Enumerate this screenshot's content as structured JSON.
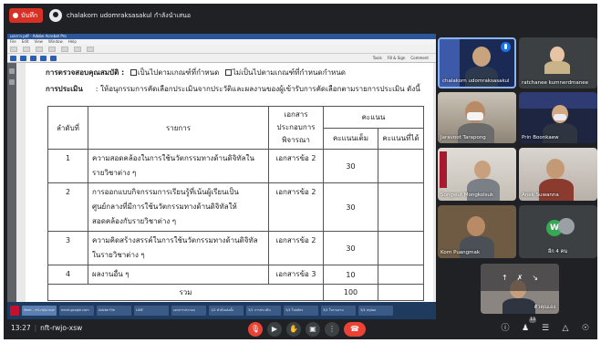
{
  "meeting": {
    "recording_label": "บันทึก",
    "presenter_name": "chalakorn udomraksasakul กำลังนำเสนอ",
    "time": "13:27",
    "meeting_code": "nft-rwjo-xsw",
    "participant_count": "13"
  },
  "shared_screen": {
    "app_title": "เอกสาร.pdf - Adobe Acrobat Pro",
    "menu": [
      "File",
      "Edit",
      "View",
      "Window",
      "Help"
    ],
    "toolbar_right": [
      "Tools",
      "Fill & Sign",
      "Comment"
    ],
    "document": {
      "criteria_label": "การตรวจสอบคุณสมบัติ :",
      "criteria_option_1": "เป็นไปตามเกณฑ์ที่กำหนด",
      "criteria_option_2": "ไม่เป็นไปตามเกณฑ์ที่กำหนดกำหนด",
      "method_label": "การประเมิน",
      "method_text": ": ให้อนุกรรมการคัดเลือกประเมินจากประวัติและผลงานของผู้เข้ารับการคัดเลือกตามรายการประเมิน ดังนี้",
      "table": {
        "headers": {
          "no": "ลำดับที่",
          "item": "รายการ",
          "doc": "เอกสาร ประกอบการ พิจารณา",
          "score": "คะแนน",
          "full": "คะแนนเต็ม",
          "got": "คะแนนที่ได้"
        },
        "rows": [
          {
            "no": "1",
            "item": "ความสอดคล้องในการใช้นวัตกรรมทางด้านดิจิทัลในรายวิชาต่าง ๆ",
            "doc": "เอกสารข้อ 2",
            "full": "30",
            "got": ""
          },
          {
            "no": "2",
            "item": "การออกแบบกิจกรรมการเรียนรู้ที่เน้นผู้เรียนเป็นศูนย์กลางที่มีการใช้นวัตกรรมทางด้านดิจิทัลให้สอดคล้องกับรายวิชาต่าง ๆ",
            "doc": "เอกสารข้อ 2",
            "full": "30",
            "got": ""
          },
          {
            "no": "3",
            "item": "ความคิดสร้างสรรค์ในการใช้นวัตกรรมทางด้านดิจิทัลในรายวิชาต่าง ๆ",
            "doc": "เอกสารข้อ 2",
            "full": "30",
            "got": ""
          },
          {
            "no": "4",
            "item": "ผลงานอื่น ๆ",
            "doc": "เอกสารข้อ 3",
            "full": "10",
            "got": ""
          }
        ],
        "total_label": "รวม",
        "total_full": "100"
      }
    },
    "taskbar_items": [
      "Meet - nft-rwjo-xsw",
      "meet.google.com",
      "Adobe File",
      "LINE",
      "เอกสารประกอบ",
      "1/2 คำสั่งแต่งตั้ง",
      "3/1 การประเมิน",
      "3/4 ใบสมัคร",
      "3/4 ใบรายงาน",
      "3/4 สรุปผล"
    ]
  },
  "participants": [
    {
      "name": "chalakorn udomraksasakul"
    },
    {
      "name": "ratchanee kumnerdmanee"
    },
    {
      "name": "Jaravoot Tarapong"
    },
    {
      "name": "Prin Boonkaew"
    },
    {
      "name": "Songwut Mongkolsuk"
    },
    {
      "name": "Anek Suwanna"
    },
    {
      "name": "Korn Puangmak"
    },
    {
      "name": "อีก 4 คน",
      "avatar_letter": "W"
    },
    {
      "name": "ตัวคุณเอง"
    }
  ],
  "controls": {
    "mic": "mic-off-icon",
    "camera": "camera-icon",
    "hand": "raise-hand-icon",
    "present": "present-icon",
    "more": "more-icon",
    "end": "end-call-icon"
  },
  "colors": {
    "background": "#202124",
    "accent": "#8ab4f8",
    "end_call": "#ea4335",
    "recording": "#d93025"
  }
}
